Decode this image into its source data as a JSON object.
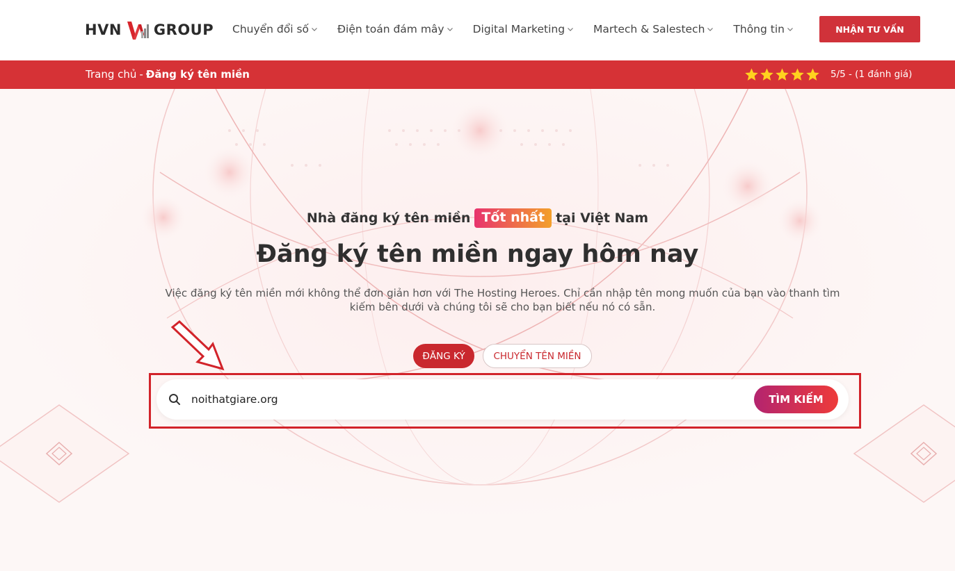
{
  "header": {
    "logo": {
      "left": "HVN",
      "right": "GROUP"
    },
    "nav": [
      {
        "label": "Chuyển đổi số"
      },
      {
        "label": "Điện toán đám mây"
      },
      {
        "label": "Digital Marketing"
      },
      {
        "label": "Martech & Salestech"
      },
      {
        "label": "Thông tin"
      }
    ],
    "cta_label": "NHẬN TƯ VẤN"
  },
  "breadcrumb": {
    "home": "Trang chủ",
    "separator": "-",
    "current": "Đăng ký tên miền"
  },
  "rating": {
    "stars": 5,
    "text": "5/5 - (1 đánh giá)"
  },
  "hero": {
    "tagline_before": "Nhà đăng ký tên miền",
    "tagline_badge": "Tốt nhất",
    "tagline_after": "tại Việt Nam",
    "headline": "Đăng ký tên miền ngay hôm nay",
    "description_line1": "Việc đăng ký tên miền mới không thể đơn giản hơn với The Hosting Heroes. Chỉ cần nhập tên mong muốn của bạn vào thanh tìm",
    "description_line2": "kiếm bên dưới và chúng tôi sẽ cho bạn biết nếu nó có sẵn."
  },
  "tabs": [
    {
      "label": "ĐĂNG KÝ",
      "active": true
    },
    {
      "label": "CHUYỂN TÊN MIỀN",
      "active": false
    }
  ],
  "search": {
    "value": "noithatgiare.org",
    "button_label": "TÌM KIẾM"
  },
  "colors": {
    "brand_red": "#d63236",
    "badge_gradient": [
      "#e8336e",
      "#f3a02b"
    ],
    "button_gradient": [
      "#b3246f",
      "#ee3b3a"
    ],
    "star": "#ffd21f"
  }
}
